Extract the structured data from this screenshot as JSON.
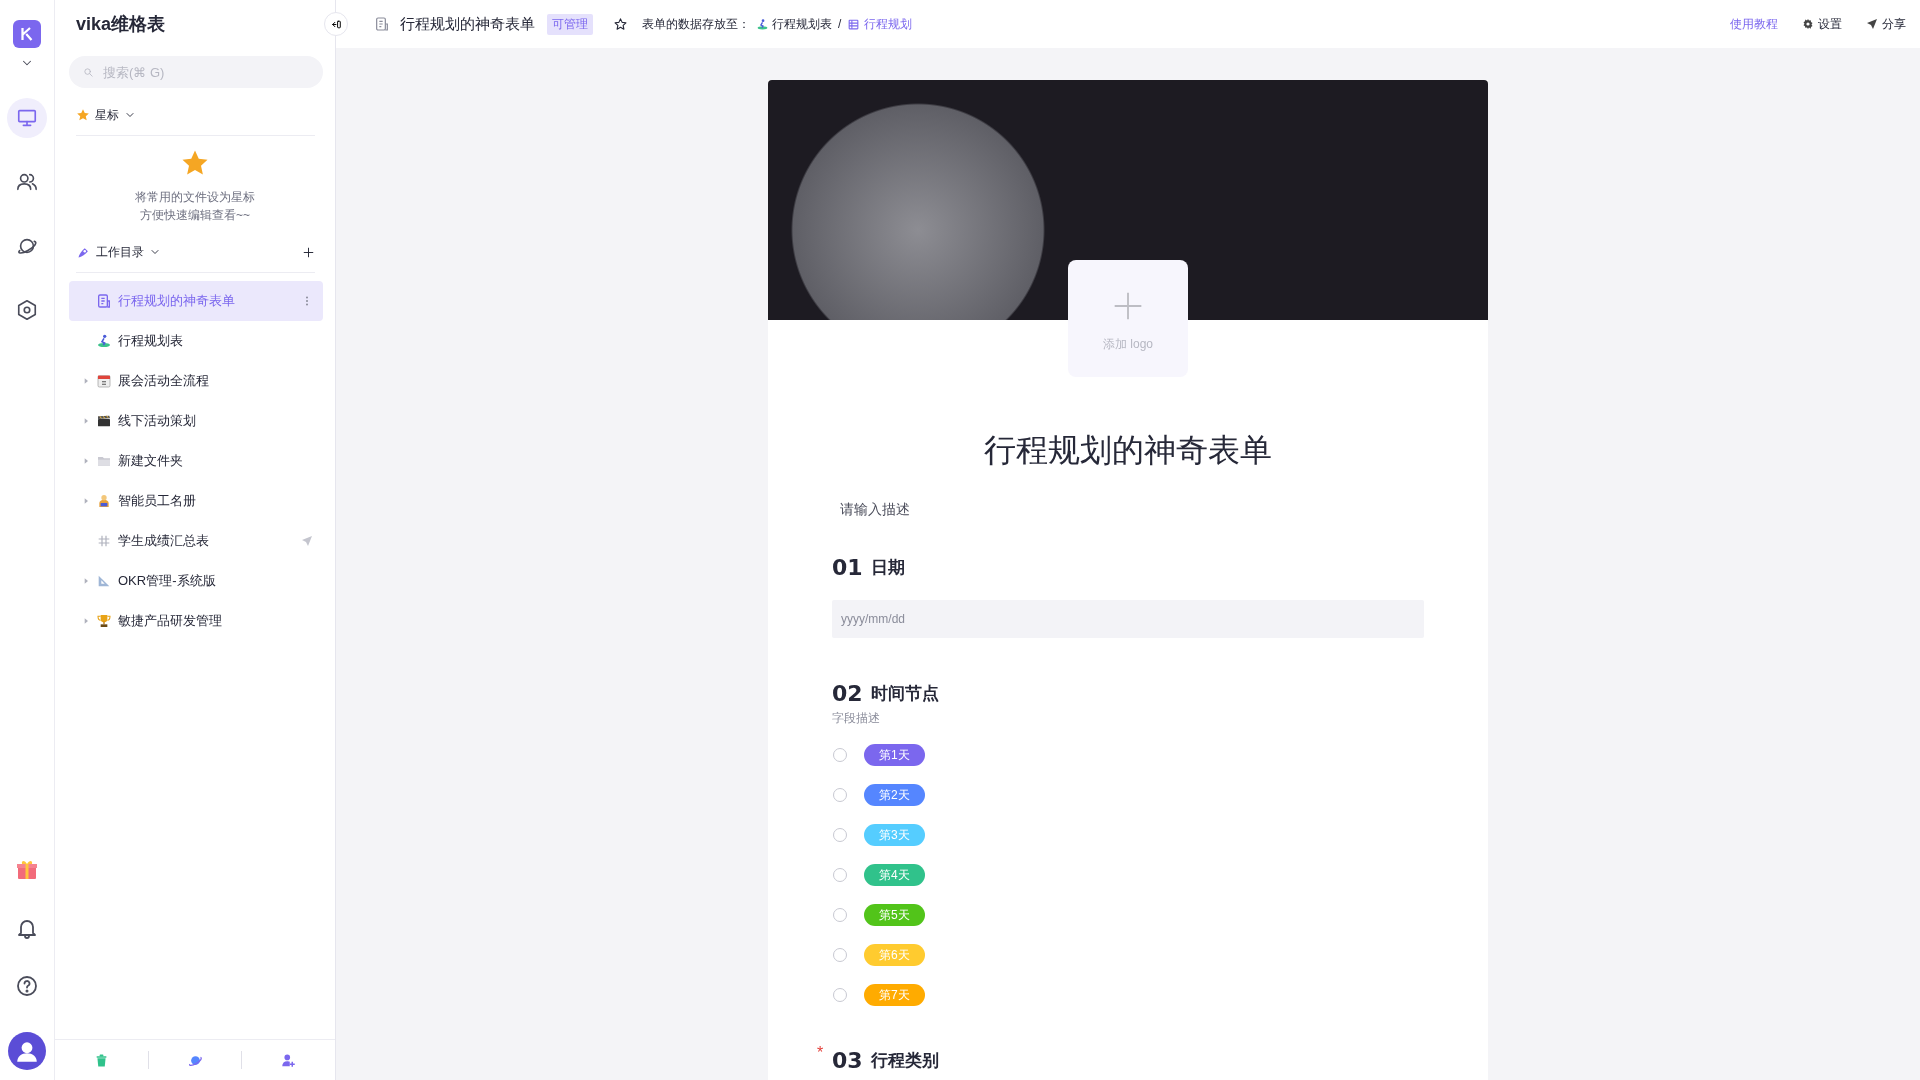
{
  "rail": {
    "items": [
      {
        "kind": "workbench",
        "selected": true
      },
      {
        "kind": "contacts",
        "selected": false
      },
      {
        "kind": "planet",
        "selected": false
      },
      {
        "kind": "admin",
        "selected": false
      }
    ],
    "bottom": [
      {
        "kind": "gift"
      },
      {
        "kind": "bell"
      },
      {
        "kind": "help"
      },
      {
        "kind": "avatar"
      }
    ]
  },
  "sidebar": {
    "space_name": "vika维格表",
    "search": {
      "placeholder": "搜索(⌘ G)"
    },
    "starred": {
      "label": "星标",
      "empty_lines": [
        "将常用的文件设为星标",
        "方便快速编辑查看~~"
      ]
    },
    "catalog": {
      "label": "工作目录"
    },
    "items": [
      {
        "label": "行程规划的神奇表单",
        "kind": "form",
        "selected": true,
        "expandable": false,
        "shared": false
      },
      {
        "label": "行程规划表",
        "kind": "sheet",
        "selected": false,
        "expandable": false,
        "shared": false
      },
      {
        "label": "展会活动全流程",
        "kind": "calendar",
        "selected": false,
        "expandable": true,
        "shared": false
      },
      {
        "label": "线下活动策划",
        "kind": "clapper",
        "selected": false,
        "expandable": true,
        "shared": false
      },
      {
        "label": "新建文件夹",
        "kind": "folder",
        "selected": false,
        "expandable": true,
        "shared": false
      },
      {
        "label": "智能员工名册",
        "kind": "person",
        "selected": false,
        "expandable": true,
        "shared": false
      },
      {
        "label": "学生成绩汇总表",
        "kind": "grid",
        "selected": false,
        "expandable": false,
        "shared": true
      },
      {
        "label": "OKR管理-系统版",
        "kind": "ruler",
        "selected": false,
        "expandable": true,
        "shared": false
      },
      {
        "label": "敏捷产品研发管理",
        "kind": "trophy",
        "selected": false,
        "expandable": true,
        "shared": false
      }
    ],
    "footer": [
      {
        "kind": "trash"
      },
      {
        "kind": "planet"
      },
      {
        "kind": "invite"
      }
    ]
  },
  "topbar": {
    "title": "行程规划的神奇表单",
    "permission": "可管理",
    "storage_label": "表单的数据存放至：",
    "storage_sheet": "行程规划表",
    "separator": "/",
    "storage_view": "行程规划",
    "links": [
      {
        "kind": "tutorial",
        "label": "使用教程"
      },
      {
        "kind": "settings",
        "label": "设置"
      },
      {
        "kind": "share",
        "label": "分享"
      }
    ]
  },
  "form": {
    "add_logo": "添加 logo",
    "required_mark": "*",
    "title": "行程规划的神奇表单",
    "description": "请输入描述",
    "fields": [
      {
        "kind": "date",
        "number": "01",
        "label": "日期",
        "required": false,
        "placeholder": "yyyy/mm/dd"
      },
      {
        "kind": "single_select",
        "number": "02",
        "label": "时间节点",
        "required": false,
        "hint": "字段描述",
        "options": [
          {
            "label": "第1天",
            "color": "#7b67ee",
            "selected": false
          },
          {
            "label": "第2天",
            "color": "#5586ff",
            "selected": false
          },
          {
            "label": "第3天",
            "color": "#55cdff",
            "selected": false
          },
          {
            "label": "第4天",
            "color": "#30c28b",
            "selected": false
          },
          {
            "label": "第5天",
            "color": "#52c41a",
            "selected": false
          },
          {
            "label": "第6天",
            "color": "#ffcb2f",
            "selected": false
          },
          {
            "label": "第7天",
            "color": "#ffab00",
            "selected": false
          }
        ]
      },
      {
        "kind": "cut_off",
        "number": "03",
        "label": "行程类别",
        "required": true
      }
    ]
  }
}
